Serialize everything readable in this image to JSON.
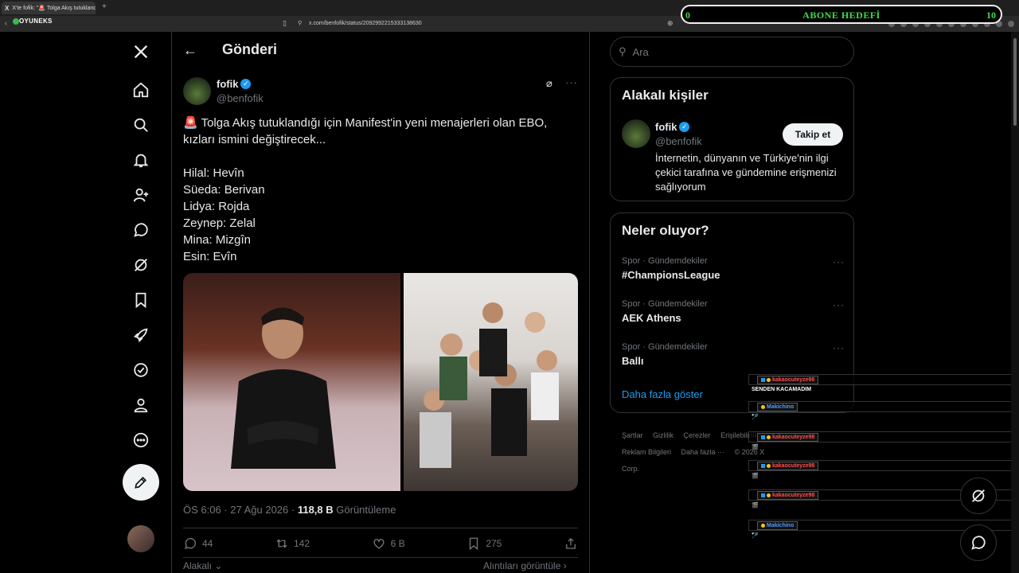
{
  "browser": {
    "tab_title": "X'te fofik: \"🚨 Tolga Akış tutuklandı",
    "url": "x.com/benfofik/status/2092992215333138630"
  },
  "overlay": {
    "brand": "OYUNEKS",
    "goal_start": "0",
    "goal_title": "ABONE HEDEFİ",
    "goal_end": "10"
  },
  "nav": {
    "icons": [
      "x-logo-icon",
      "home-icon",
      "search-icon",
      "notifications-icon",
      "follow-icon",
      "chat-icon",
      "grok-icon",
      "bookmarks-icon",
      "rocket-icon",
      "verified-icon",
      "profile-icon",
      "more-icon"
    ]
  },
  "post": {
    "header_title": "Gönderi",
    "author_name": "fofik",
    "author_handle": "@benfofik",
    "text": "🚨 Tolga Akış tutuklandığı için Manifest'in yeni menajerleri olan EBO, kızları ismini değiştirecek...\n\nHilal: Hevîn\nSüeda: Berivan\nLidya: Rojda\nZeynep: Zelal\nMina: Mizgîn\nEsin: Evîn",
    "time": "ÖS 6:06 · 27 Ağu 2026 · ",
    "views_count": "118,8 B",
    "views_label": "Görüntüleme",
    "replies": "44",
    "reposts": "142",
    "likes": "6 B",
    "bookmarks": "275",
    "related_label": "Alakalı",
    "quotes_label": "Alıntıları görüntüle"
  },
  "right": {
    "search_placeholder": "Ara",
    "people_title": "Alakalı kişiler",
    "person_name": "fofik",
    "person_handle": "@benfofik",
    "follow_label": "Takip et",
    "person_bio": "İnternetin, dünyanın ve Türkiye'nin ilgi çekici tarafına ve gündemine erişmenizi sağlıyorum",
    "trends_title": "Neler oluyor?",
    "trends": [
      {
        "category": "Spor · Gündemdekiler",
        "name": "#ChampionsLeague"
      },
      {
        "category": "Spor · Gündemdekiler",
        "name": "AEK Athens"
      },
      {
        "category": "Spor · Gündemdekiler",
        "name": "Ballı"
      }
    ],
    "show_more": "Daha fazla göster",
    "footer": [
      "Şartlar",
      "Gizlilik",
      "Çerezler",
      "Erişilebilirlik",
      "Reklam Bilgileri",
      "Daha fazla ···",
      "© 2026 X Corp."
    ]
  },
  "chat": [
    {
      "user": "kakaocuteyze98",
      "color": "#ff4d4d",
      "message": "SENDEN KACAMADIM"
    },
    {
      "user": "Makichino",
      "color": "#4d9dff",
      "message": "🏸"
    },
    {
      "user": "kakaocuteyze98",
      "color": "#ff4d4d",
      "message": "🎬"
    },
    {
      "user": "kakaocuteyze98",
      "color": "#ff4d4d",
      "message": "🎬"
    },
    {
      "user": "kakaocuteyze98",
      "color": "#ff4d4d",
      "message": "🎬"
    },
    {
      "user": "Makichino",
      "color": "#4d9dff",
      "message": "🏸"
    }
  ]
}
